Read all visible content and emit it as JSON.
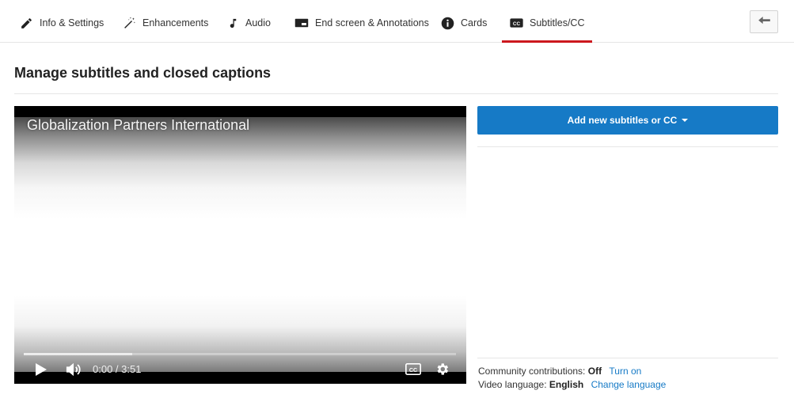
{
  "tabs": [
    {
      "label": "Info & Settings",
      "icon": "pencil-icon"
    },
    {
      "label": "Enhancements",
      "icon": "magic-wand-icon"
    },
    {
      "label": "Audio",
      "icon": "music-note-icon"
    },
    {
      "label": "End screen & Annotations",
      "icon": "end-screen-icon"
    },
    {
      "label": "Cards",
      "icon": "info-icon"
    },
    {
      "label": "Subtitles/CC",
      "icon": "cc-icon",
      "active": true
    }
  ],
  "back_button": {
    "icon": "back-arrow-icon"
  },
  "page": {
    "title": "Manage subtitles and closed captions"
  },
  "player": {
    "video_title": "Globalization Partners International",
    "time": "0:00 / 3:51",
    "progress": 0,
    "buffered": 0.25,
    "icons": [
      "play-icon",
      "volume-icon",
      "cc-icon",
      "gear-icon"
    ]
  },
  "subtitles": {
    "add_button": "Add new subtitles or CC",
    "community_label": "Community contributions:",
    "community_value": "Off",
    "community_link": "Turn on",
    "language_label": "Video language:",
    "language_value": "English",
    "language_link": "Change language"
  },
  "colors": {
    "accent_blue": "#167ac6",
    "active_tab_red": "#cc181e"
  }
}
